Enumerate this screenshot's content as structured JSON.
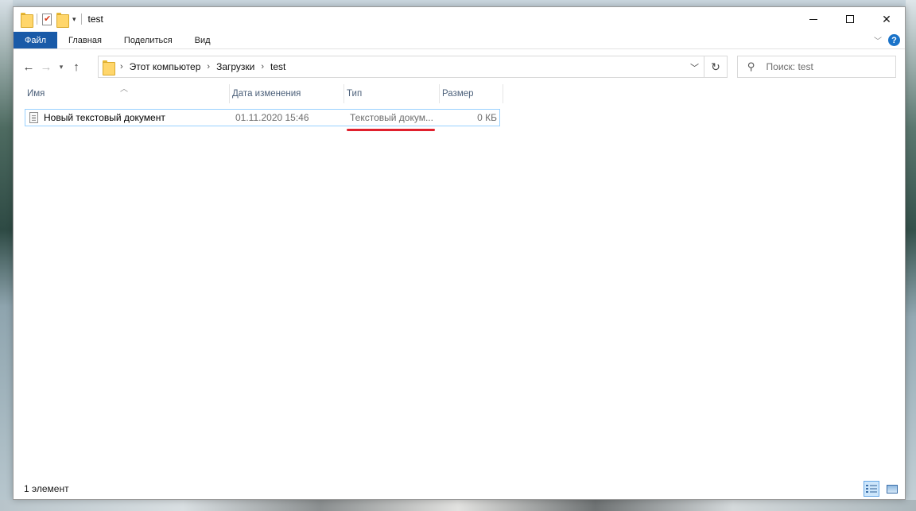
{
  "window": {
    "title": "test",
    "controls": {
      "minimize": "",
      "maximize": "",
      "close": "✕"
    }
  },
  "ribbon": {
    "tabs": [
      "Файл",
      "Главная",
      "Поделиться",
      "Вид"
    ],
    "help": "?"
  },
  "navigation": {
    "breadcrumb": [
      "Этот компьютер",
      "Загрузки",
      "test"
    ],
    "search_placeholder": "Поиск: test"
  },
  "columns": [
    "Имя",
    "Дата изменения",
    "Тип",
    "Размер"
  ],
  "files": [
    {
      "name": "Новый текстовый документ",
      "date": "01.11.2020 15:46",
      "type": "Текстовый докум...",
      "size": "0 КБ"
    }
  ],
  "status": {
    "count": "1 элемент"
  },
  "colors": {
    "accent": "#195aa8",
    "selection_border": "#99d1ff",
    "annotation": "#e0202d"
  }
}
